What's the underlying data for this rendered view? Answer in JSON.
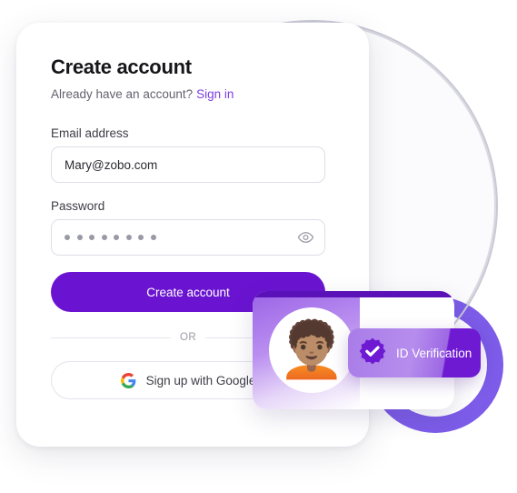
{
  "card": {
    "title": "Create account",
    "subtitle_text": "Already have an account?",
    "signin_label": "Sign in",
    "email": {
      "label": "Email address",
      "value": "Mary@zobo.com",
      "placeholder": "Email address"
    },
    "password": {
      "label": "Password",
      "masked_value": "••••••••",
      "dot_count": 8,
      "placeholder": "Password",
      "toggle_icon": "eye-icon"
    },
    "primary_button": "Create account",
    "divider_label": "OR",
    "google_button": "Sign up with Google",
    "google_icon": "google-g-icon"
  },
  "verification": {
    "avatar_icon": "person-with-glasses-braids-avatar",
    "avatar_glyph": "🧑🏽‍🦱",
    "badge_label": "ID Verification",
    "badge_icon": "verified-seal-check-icon"
  },
  "colors": {
    "brand_purple": "#6A14D1",
    "link_purple": "#7B3FE4",
    "badge_purple": "#6E1AD3",
    "ring_purple": "#7C5CE8",
    "text_dark": "#16161A",
    "text_muted": "#62626E",
    "border_grey": "#DEDEE6"
  }
}
